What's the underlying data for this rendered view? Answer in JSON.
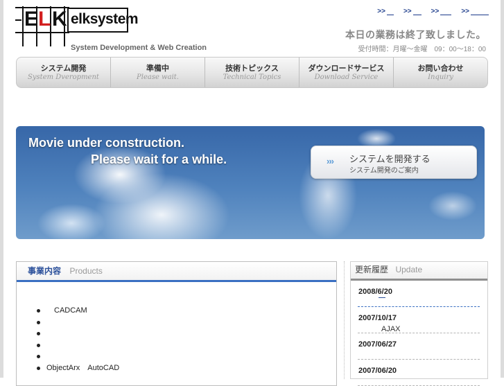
{
  "logo": {
    "letters": [
      "E",
      "L",
      "K"
    ],
    "name": "elksystem",
    "tagline": "System Development &  Web Creation",
    "colors": {
      "red": "#d21f1f",
      "dark": "#111111"
    }
  },
  "top_links": [
    {
      "arrow": ">>",
      "label": "_"
    },
    {
      "arrow": ">>",
      "label": "_"
    },
    {
      "arrow": ">>",
      "label": "__"
    },
    {
      "arrow": ">>",
      "label": "____"
    }
  ],
  "status": {
    "message": "本日の業務は終了致しました。",
    "hours": "受付時間：月曜～金曜　09：00～18：00"
  },
  "nav": [
    {
      "jp": "システム開発",
      "en": "System Dveropment"
    },
    {
      "jp": "準備中",
      "en": "Please wait."
    },
    {
      "jp": "技術トピックス",
      "en": "Technical Topics"
    },
    {
      "jp": "ダウンロードサービス",
      "en": "Download Service"
    },
    {
      "jp": "お問い合わせ",
      "en": "Inquiry"
    }
  ],
  "banner": {
    "line1": "Movie under construction.",
    "line2": "Please wait for a while.",
    "button": {
      "icon": "double-chevron-right-icon",
      "title": "システムを開発する",
      "subtitle": "システム開発のご案内"
    }
  },
  "products": {
    "title_jp": "事業内容",
    "title_en": "Products",
    "items": [
      "　CADCAM",
      "",
      "",
      "",
      "",
      "ObjectArx　AutoCAD"
    ]
  },
  "updates": {
    "title_jp": "更新履歴",
    "title_en": "Update",
    "items": [
      {
        "date": "2008/6/20",
        "text": ""
      },
      {
        "date": "2007/10/17",
        "text": "AJAX"
      },
      {
        "date": "2007/06/27",
        "text": ""
      },
      {
        "date": "2007/06/20",
        "text": ""
      }
    ]
  },
  "colors": {
    "accent_blue": "#3a6fc2",
    "link": "#1a3a8a"
  }
}
